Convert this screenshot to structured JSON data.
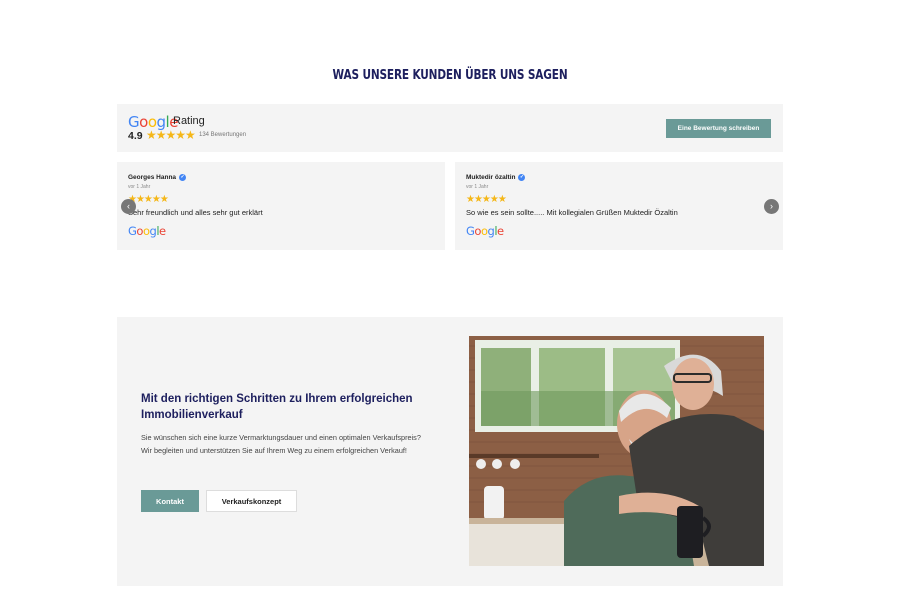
{
  "testimonials": {
    "title": "WAS UNSERE KUNDEN ÜBER UNS SAGEN",
    "rating": {
      "brand": "Google",
      "label": "Rating",
      "score": "4.9",
      "stars": "★★★★★",
      "count": "134 Bewertungen",
      "write_button": "Eine Bewertung schreiben"
    },
    "reviews": [
      {
        "name": "Georges Hanna",
        "time": "vor 1 Jahr",
        "stars": "★★★★★",
        "text": "Sehr freundlich und alles sehr gut erklärt",
        "source": "Google"
      },
      {
        "name": "Muktedir özaltin",
        "time": "vor 1 Jahr",
        "stars": "★★★★★",
        "text": "So wie es sein sollte..... Mit kollegialen Grüßen Muktedir Özaltin",
        "source": "Google"
      }
    ],
    "prev_icon": "chevron-left-icon",
    "next_icon": "chevron-right-icon",
    "verified_icon": "verified-check-icon"
  },
  "promo": {
    "heading": "Mit den richtigen Schritten zu Ihrem erfolgreichen Immobilienverkauf",
    "text": "Sie wünschen sich eine kurze Vermarktungsdauer und einen optimalen Verkaufspreis? Wir begleiten und unterstützen Sie auf Ihrem Weg zu einem erfolgreichen Verkauf!",
    "contact_button": "Kontakt",
    "concept_button": "Verkaufskonzept",
    "photo": "couple-photo"
  },
  "colors": {
    "navy": "#1d1f5e",
    "accent": "#6a9a97",
    "star": "#f5b718",
    "panel": "#f4f4f4"
  }
}
